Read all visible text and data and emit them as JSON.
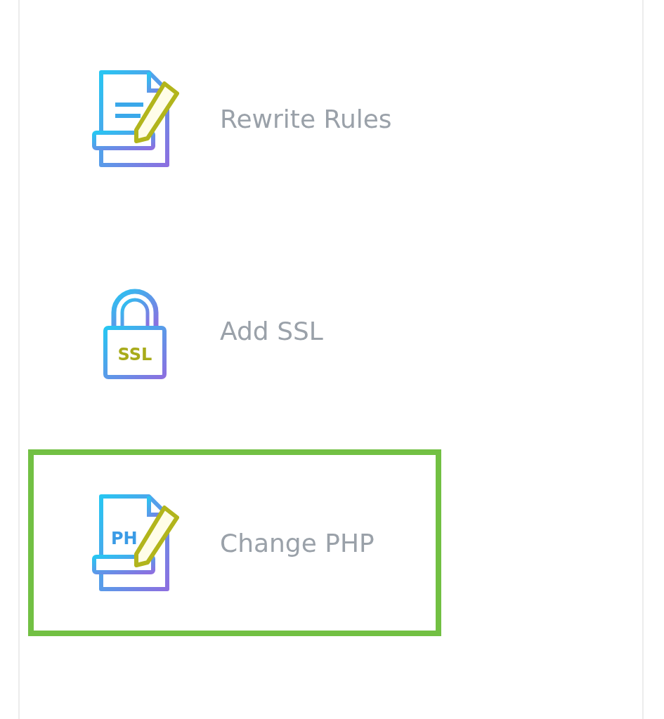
{
  "tools": [
    {
      "kind": "document",
      "label": "Rewrite Rules",
      "selected": false
    },
    {
      "kind": "lock",
      "icon_text": "SSL",
      "label": "Add SSL",
      "selected": false
    },
    {
      "kind": "php",
      "icon_text": "PH",
      "label": "Change PHP",
      "selected": true
    }
  ]
}
